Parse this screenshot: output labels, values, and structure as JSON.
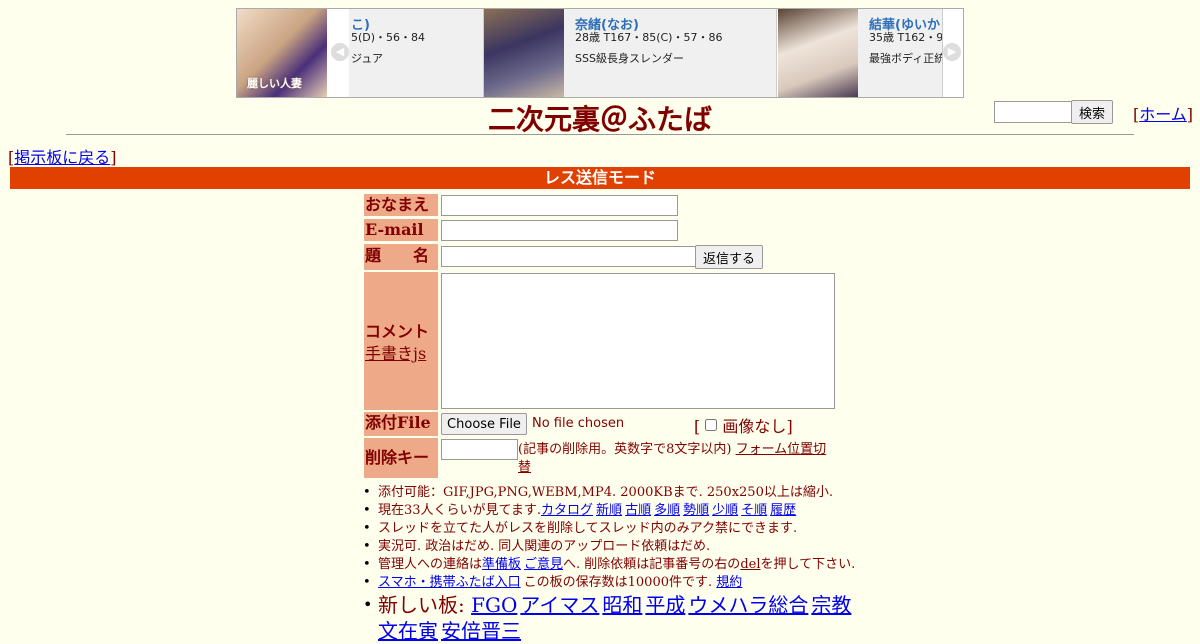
{
  "ad": {
    "logo_text": "麗しい人妻",
    "cards": [
      {
        "name": "こ)",
        "spec": "5(D)・56・84",
        "desc": "ジュア"
      },
      {
        "name": "奈緒(なお)",
        "spec": "28歳 T167・85(C)・57・86",
        "desc": "SSS級長身スレンダー"
      },
      {
        "name": "結華(ゆいか",
        "spec": "35歳 T162・9",
        "desc": "最強ボディ正統"
      }
    ]
  },
  "header": {
    "title": "二次元裏＠ふたば",
    "search_button": "検索",
    "home_link": "ホーム",
    "back_link": "掲示板に戻る"
  },
  "mode_bar": "レス送信モード",
  "form": {
    "name_label": "おなまえ",
    "email_label": "E-mail",
    "subject_label": "題　　名",
    "submit_button": "返信する",
    "comment_label": "コメント",
    "handwriting_link": "手書きjs",
    "attach_label": "添付File",
    "file_button": "Choose File",
    "file_status": "No file chosen",
    "no_image_label": "画像なし",
    "delete_key_label": "削除キー",
    "delete_key_note": "(記事の削除用。英数字で8文字以内)",
    "form_position_link": "フォーム位置切替"
  },
  "notes": {
    "line1": "添付可能：GIF,JPG,PNG,WEBM,MP4. 2000KBまで. 250x250以上は縮小.",
    "line2_prefix": "現在33人くらいが見てます.",
    "line2_links": [
      "カタログ",
      "新順",
      "古順",
      "多順",
      "勢順",
      "少順",
      "そ順",
      "履歴"
    ],
    "line3": "スレッドを立てた人がレスを削除してスレッド内のみアク禁にできます.",
    "line4": "実況可. 政治はだめ. 同人関連のアップロード依頼はだめ.",
    "line5_a": "管理人への連絡は",
    "line5_link1": "準備板",
    "line5_link2": "ご意見",
    "line5_b": "へ. 削除依頼は記事番号の右の",
    "line5_del": "del",
    "line5_c": "を押して下さい.",
    "line6_link": "スマホ・携帯ふたば入口",
    "line6_text": "この板の保存数は10000件です.",
    "line6_rules": "規約",
    "new_boards_label": "新しい板:",
    "new_boards": [
      "FGO",
      "アイマス",
      "昭和",
      "平成",
      "ウメハラ総合",
      "宗教"
    ],
    "new_boards_row2": [
      "文在寅",
      "安倍晋三"
    ]
  },
  "colors": {
    "background": "#FFFFEE",
    "text": "#800000",
    "mode_bar": "#E04000",
    "label_bg": "#EEAA88",
    "link": "#0000EE"
  }
}
